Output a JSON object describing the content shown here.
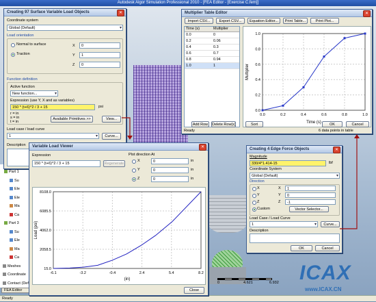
{
  "app": {
    "title": "Autodesk Algor Simulation Professional 2010 - [FEA Editor - [Exercise C.fem]]",
    "status": "Ready"
  },
  "colors": {
    "mesh": "#7f63b8",
    "accent_arrow": "#a01010",
    "highlight": "#fff36b"
  },
  "left_tree": {
    "items": [
      "Part 1",
      "Su",
      "Ele",
      "Ele",
      "Ma",
      "Ca",
      "Part 3",
      "Su",
      "Ele",
      "Ma",
      "Ca",
      "Meshes",
      "Coordinate",
      "Contact (Default)"
    ],
    "tab": "FEA Editor"
  },
  "surface_dialog": {
    "title": "Creating 97 Surface Variable Load Objects",
    "coord_label": "Coordinate system",
    "coord_value": "Global (Default)",
    "orientation_label": "Load orientation",
    "normal_label": "Normal to surface",
    "traction_label": "Traction",
    "x_label": "X",
    "y_label": "Y",
    "z_label": "Z",
    "x_value": "0",
    "y_value": "1",
    "z_value": "0",
    "function_label": "Function definition",
    "active_label": "Active function",
    "active_value": "New function...",
    "expr_label": "Expression (use Y, X and as variables)",
    "expr_value": "150 * (t+6)^2 / 3 + 15",
    "unit": "psi",
    "vars": [
      "r = in",
      "s = in",
      "t = in"
    ],
    "primitives_button": "Available Primitives >>",
    "view_button": "View...",
    "curve_label": "Load case / load curve",
    "curve_value": "1",
    "curve_button": "Curve...",
    "desc_label": "Description"
  },
  "multiplier_dialog": {
    "title": "Multiplier Table Editor",
    "toolbar": [
      "Import CSV...",
      "Export CSV...",
      "Equation Editor...",
      "Print Table...",
      "Print Plot..."
    ],
    "columns": [
      "Time (s)",
      "Multiplier"
    ],
    "rows": [
      [
        "0.0",
        "0"
      ],
      [
        "0.2",
        "0.06"
      ],
      [
        "0.4",
        "0.3"
      ],
      [
        "0.6",
        "0.7"
      ],
      [
        "0.8",
        "0.94"
      ],
      [
        "1.0",
        "1"
      ]
    ],
    "add_row": "Add Row",
    "delete_row": "Delete Row(s)",
    "sort": "Sort",
    "ok": "OK",
    "cancel": "Cancel",
    "status": "Ready",
    "info": "6 data points in table",
    "chart_data": {
      "type": "line",
      "x": [
        0.0,
        0.2,
        0.4,
        0.6,
        0.8,
        1.0
      ],
      "y": [
        0,
        0.06,
        0.3,
        0.7,
        0.94,
        1
      ],
      "xlabel": "Time (s)",
      "ylabel": "Multiplier",
      "xlim": [
        0,
        1
      ],
      "ylim": [
        0,
        1
      ],
      "xticks": [
        "0.0",
        "0.2",
        "0.4",
        "0.6",
        "0.8",
        "1.0"
      ],
      "yticks": [
        "0.0",
        "0.2",
        "0.4",
        "0.6",
        "0.8",
        "1.0"
      ],
      "grid": true
    }
  },
  "viewer_dialog": {
    "title": "Variable Load Viewer",
    "expr_label": "Expression",
    "expr_value": "150 * (t+6)^2 / 3 + 15",
    "regenerate": "Regenerate",
    "plot_dir_label": "Plot direction",
    "at_label": "At",
    "x_label": "X",
    "y_label": "Y",
    "z_label": "Z",
    "x_value": "0",
    "y_value": "0",
    "z_value": "0",
    "unit": "in",
    "close": "Close",
    "chart_data": {
      "type": "line",
      "x": [
        -6.1,
        -4.5,
        -3.2,
        -1.8,
        -0.4,
        1.0,
        2.4,
        3.8,
        5.4,
        8.2
      ],
      "y": [
        15,
        60,
        150,
        350,
        880,
        1550,
        2450,
        3500,
        4950,
        8120
      ],
      "xlabel": "(in)",
      "ylabel": "Load (psi)",
      "xlim": [
        -6.1,
        8.2
      ],
      "ylim": [
        15,
        8120
      ],
      "xticks": [
        "-6.1",
        "-3.2",
        "-0.4",
        "2.4",
        "5.4",
        "8.2"
      ],
      "yticks": [
        "15.0",
        "2058.5",
        "4062.0",
        "6085.5",
        "8108.0"
      ],
      "grid": true
    }
  },
  "edge_dialog": {
    "title": "Creating 4 Edge Force Objects",
    "magnitude_label": "Magnitude",
    "magnitude_value": "330/4*1.414-15",
    "unit": "lbf",
    "coord_label": "Coordinate System",
    "coord_value": "Global (Default)",
    "direction_label": "Direction",
    "x_label": "X",
    "y_label": "Y",
    "z_label": "Z",
    "custom_label": "Custom",
    "x_value": "1",
    "y_value": "0",
    "z_value": "-1",
    "vector_button": "Vector Selector...",
    "curve_label": "Load Case / Load Curve",
    "curve_value": "1",
    "curve_button": "Curve...",
    "desc_label": "Description",
    "ok": "OK",
    "cancel": "Cancel"
  },
  "scale": {
    "values": [
      "0",
      "4.621",
      "6.932"
    ],
    "unit": "in"
  },
  "watermark": {
    "brand": "ICAX",
    "url": "www.ICAX.CN"
  }
}
